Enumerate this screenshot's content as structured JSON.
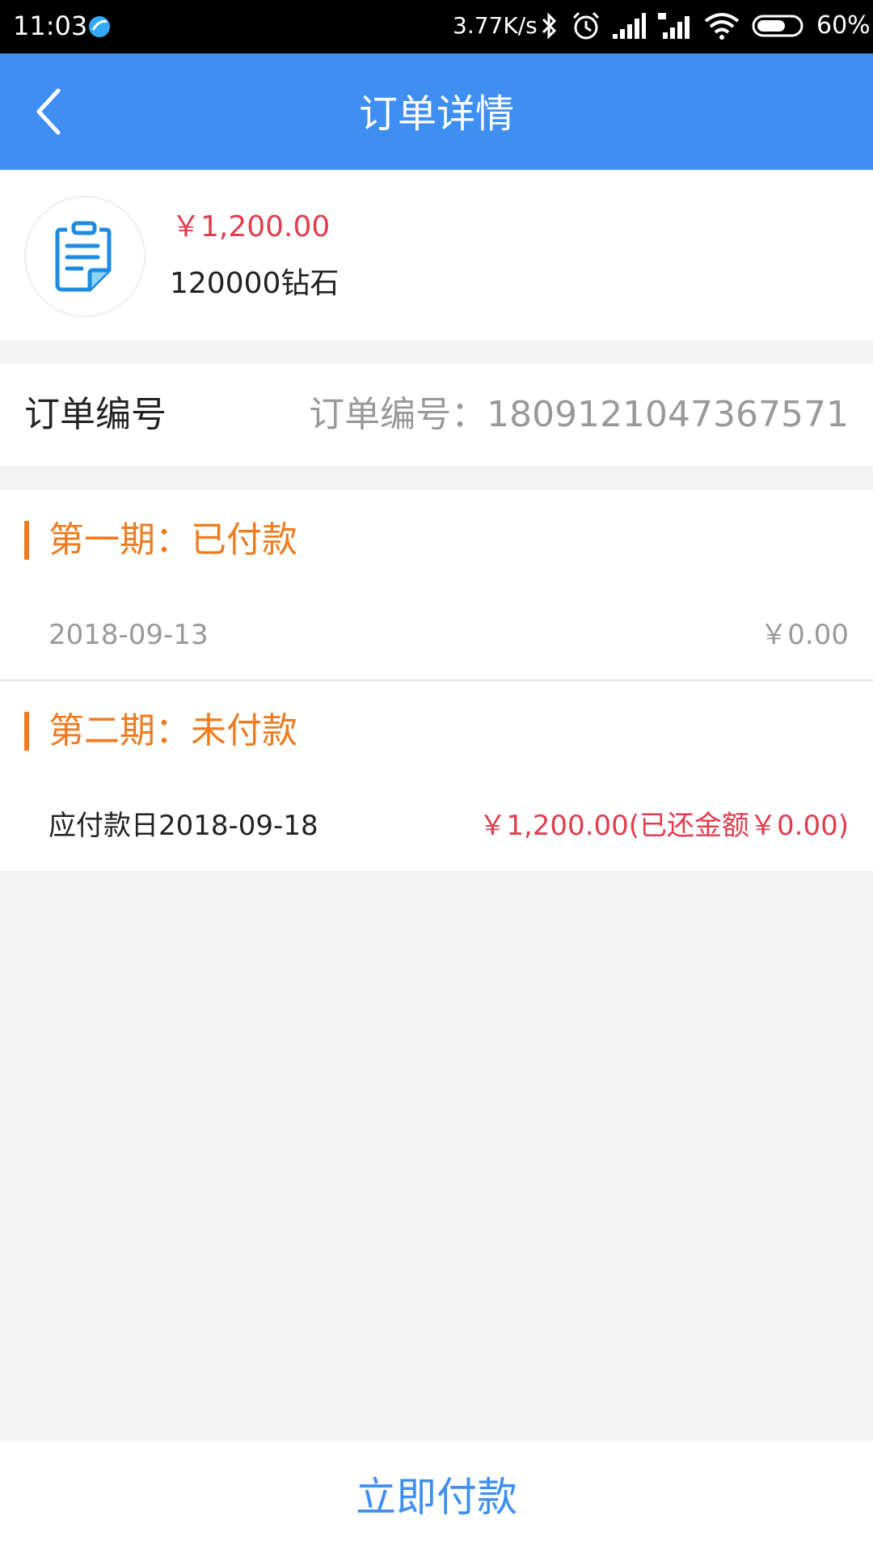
{
  "status_bar": {
    "time": "11:03",
    "network_speed": "3.77K/s",
    "battery": "60%"
  },
  "header": {
    "title": "订单详情"
  },
  "product": {
    "price": "￥1,200.00",
    "name": "120000钻石"
  },
  "order": {
    "label": "订单编号",
    "value": "订单编号：1809121047367571"
  },
  "installments": [
    {
      "title": "第一期：已付款",
      "date": "2018-09-13",
      "amount": "￥0.00"
    },
    {
      "title": "第二期：未付款",
      "date": "应付款日2018-09-18",
      "amount": "￥1,200.00(已还金额￥0.00)"
    }
  ],
  "pay_button": {
    "label": "立即付款"
  },
  "colors": {
    "header_blue": "#3f8ef2",
    "accent_orange": "#ef7b1f",
    "price_red": "#e23d4e",
    "background": "#f4f4f4"
  }
}
